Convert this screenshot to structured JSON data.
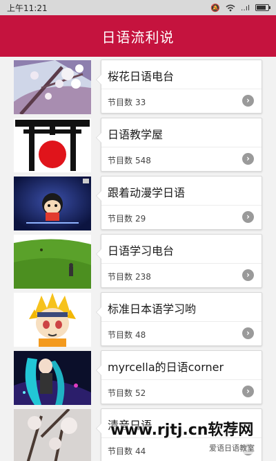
{
  "status_bar": {
    "time": "上午11:21",
    "signal": "..ıl",
    "colors": {
      "bg": "#d9d9d9"
    }
  },
  "app_bar": {
    "title": "日语流利说",
    "color": "#c5133e"
  },
  "count_label": "节目数",
  "programs": [
    {
      "title": "桜花日语电台",
      "count": "33",
      "thumb": "cherry-blossom-photo"
    },
    {
      "title": "日语教学屋",
      "count": "548",
      "thumb": "torii-rising-sun-logo"
    },
    {
      "title": "跟着动漫学日语",
      "count": "29",
      "thumb": "anime-cartoon-frame"
    },
    {
      "title": "日语学习电台",
      "count": "238",
      "thumb": "green-field-photo"
    },
    {
      "title": "标准日本语学习哟",
      "count": "48",
      "thumb": "anime-naruto-character"
    },
    {
      "title": "myrcella的日语corner",
      "count": "52",
      "thumb": "anime-vocaloid-character"
    },
    {
      "title": "清音日语",
      "count": "44",
      "thumb": "tree-blossom-photo"
    }
  ],
  "watermark": {
    "main": "www.rjtj.cn软荐网",
    "sub": "爱语日语教室"
  }
}
